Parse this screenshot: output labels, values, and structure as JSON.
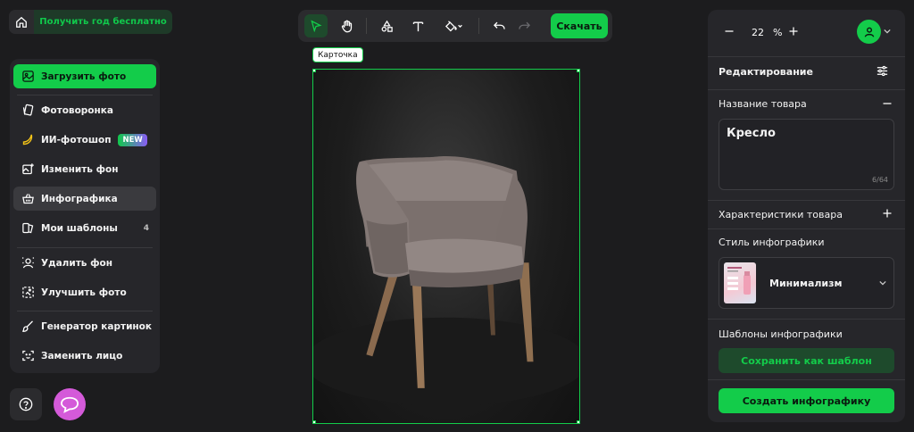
{
  "top_left": {
    "promo_label": "Получить год бесплатно"
  },
  "sidebar": {
    "items": [
      {
        "label": "Загрузить фото"
      },
      {
        "label": "Фотоворонка"
      },
      {
        "label": "ИИ-фотошоп",
        "badge": "NEW"
      },
      {
        "label": "Изменить фон"
      },
      {
        "label": "Инфографика"
      },
      {
        "label": "Мои шаблоны",
        "count": "4"
      },
      {
        "label": "Удалить фон"
      },
      {
        "label": "Улучшить фото"
      },
      {
        "label": "Генератор картинок"
      },
      {
        "label": "Заменить лицо"
      }
    ]
  },
  "toolbar": {
    "download_label": "Скачать"
  },
  "canvas": {
    "card_label": "Карточка"
  },
  "right_panel": {
    "zoom_value": "22",
    "zoom_unit": "%",
    "editing_title": "Редактирование",
    "product_name_title": "Название товара",
    "product_name_value": "Кресло",
    "product_name_counter": "6/64",
    "characteristics_title": "Характеристики товара",
    "style_title": "Стиль инфографики",
    "style_value": "Минимализм",
    "templates_title": "Шаблоны инфографики",
    "save_template_label": "Сохранить как шаблон",
    "create_label": "Создать инфографику"
  },
  "colors": {
    "accent": "#13cc4a",
    "background": "#1c1c1e",
    "panel": "#26262a",
    "chat": "#d45ad9"
  }
}
